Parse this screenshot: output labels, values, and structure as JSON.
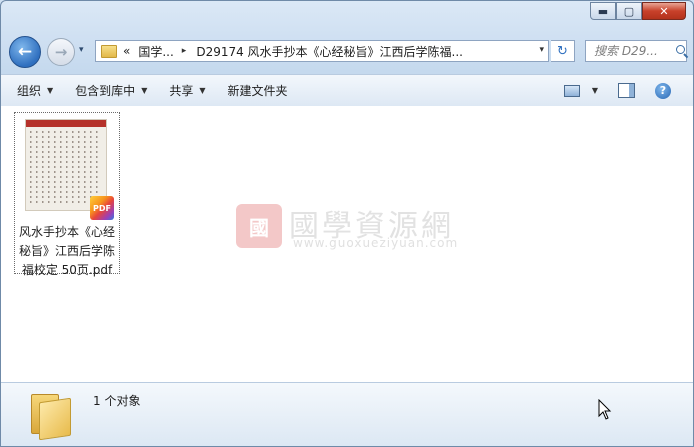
{
  "window": {
    "caption_buttons": {
      "minimize": "▬",
      "maximize": "▢",
      "close": "✕"
    }
  },
  "nav": {
    "back_glyph": "←",
    "forward_glyph": "→",
    "recent_glyph": "▾"
  },
  "address": {
    "overflow": "«",
    "crumbs": [
      "国学...",
      "D29174 风水手抄本《心经秘旨》江西后学陈福..."
    ],
    "separator": "▸",
    "dropdown": "▾",
    "refresh_glyph": "↻"
  },
  "search": {
    "placeholder": "搜索 D29..."
  },
  "toolbar": {
    "organize": "组织",
    "include_library": "包含到库中",
    "share": "共享",
    "new_folder": "新建文件夹",
    "arrow": "▼",
    "help": "?"
  },
  "file": {
    "name": "风水手抄本《心经秘旨》江西后学陈福校定 50页.pdf",
    "badge": "PDF"
  },
  "watermark": {
    "seal": "國",
    "title": "國學資源網",
    "url": "www.guoxueziyuan.com"
  },
  "details": {
    "count": "1 个对象"
  },
  "colors": {
    "accent": "#2f6fbf",
    "close": "#c8412a",
    "selection_border": "#6a6a6a"
  }
}
